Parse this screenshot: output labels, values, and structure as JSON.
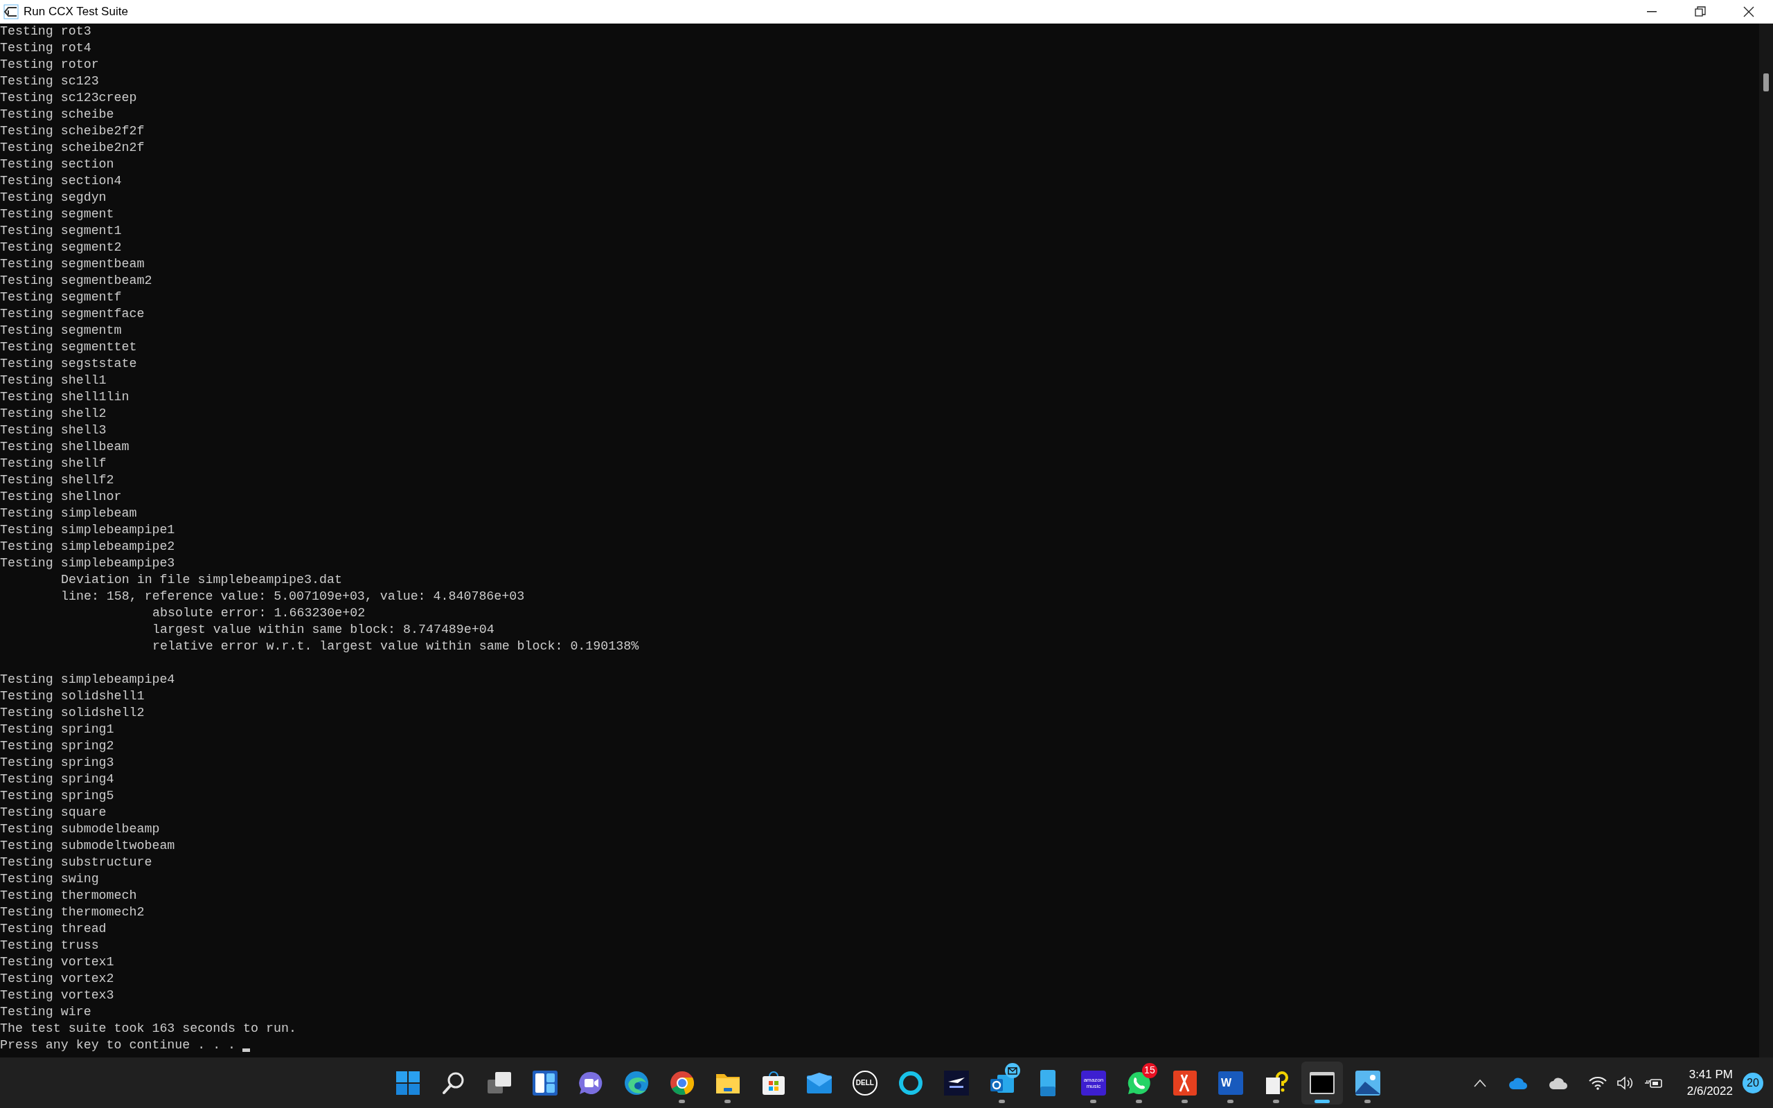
{
  "window": {
    "title": "Run CCX Test Suite"
  },
  "console": {
    "lines": [
      {
        "kind": "output",
        "text": "Testing rot3"
      },
      {
        "kind": "output",
        "text": "Testing rot4"
      },
      {
        "kind": "output",
        "text": "Testing rotor"
      },
      {
        "kind": "output",
        "text": "Testing sc123"
      },
      {
        "kind": "output",
        "text": "Testing sc123creep"
      },
      {
        "kind": "output",
        "text": "Testing scheibe"
      },
      {
        "kind": "output",
        "text": "Testing scheibe2f2f"
      },
      {
        "kind": "output",
        "text": "Testing scheibe2n2f"
      },
      {
        "kind": "output",
        "text": "Testing section"
      },
      {
        "kind": "output",
        "text": "Testing section4"
      },
      {
        "kind": "output",
        "text": "Testing segdyn"
      },
      {
        "kind": "output",
        "text": "Testing segment"
      },
      {
        "kind": "output",
        "text": "Testing segment1"
      },
      {
        "kind": "output",
        "text": "Testing segment2"
      },
      {
        "kind": "output",
        "text": "Testing segmentbeam"
      },
      {
        "kind": "output",
        "text": "Testing segmentbeam2"
      },
      {
        "kind": "output",
        "text": "Testing segmentf"
      },
      {
        "kind": "output",
        "text": "Testing segmentface"
      },
      {
        "kind": "output",
        "text": "Testing segmentm"
      },
      {
        "kind": "output",
        "text": "Testing segmenttet"
      },
      {
        "kind": "output",
        "text": "Testing segststate"
      },
      {
        "kind": "output",
        "text": "Testing shell1"
      },
      {
        "kind": "output",
        "text": "Testing shell1lin"
      },
      {
        "kind": "output",
        "text": "Testing shell2"
      },
      {
        "kind": "output",
        "text": "Testing shell3"
      },
      {
        "kind": "output",
        "text": "Testing shellbeam"
      },
      {
        "kind": "output",
        "text": "Testing shellf"
      },
      {
        "kind": "output",
        "text": "Testing shellf2"
      },
      {
        "kind": "output",
        "text": "Testing shellnor"
      },
      {
        "kind": "output",
        "text": "Testing simplebeam"
      },
      {
        "kind": "output",
        "text": "Testing simplebeampipe1"
      },
      {
        "kind": "output",
        "text": "Testing simplebeampipe2"
      },
      {
        "kind": "output",
        "text": "Testing simplebeampipe3",
        "children": [
          {
            "kind": "output",
            "text": "Deviation in file simplebeampipe3.dat"
          },
          {
            "kind": "output",
            "text": "line: 158, reference value: 5.007109e+03, value: 4.840786e+03",
            "children": [
              {
                "kind": "output",
                "text": "absolute error: 1.663230e+02"
              },
              {
                "kind": "output",
                "text": "largest value within same block: 8.747489e+04"
              },
              {
                "kind": "output",
                "text": "relative error w.r.t. largest value within same block: 0.190138%"
              }
            ]
          }
        ]
      },
      {
        "kind": "blank"
      },
      {
        "kind": "output",
        "text": "Testing simplebeampipe4"
      },
      {
        "kind": "output",
        "text": "Testing solidshell1"
      },
      {
        "kind": "output",
        "text": "Testing solidshell2"
      },
      {
        "kind": "output",
        "text": "Testing spring1"
      },
      {
        "kind": "output",
        "text": "Testing spring2"
      },
      {
        "kind": "output",
        "text": "Testing spring3"
      },
      {
        "kind": "output",
        "text": "Testing spring4"
      },
      {
        "kind": "output",
        "text": "Testing spring5"
      },
      {
        "kind": "output",
        "text": "Testing square"
      },
      {
        "kind": "output",
        "text": "Testing submodelbeamp"
      },
      {
        "kind": "output",
        "text": "Testing submodeltwobeam"
      },
      {
        "kind": "output",
        "text": "Testing substructure"
      },
      {
        "kind": "output",
        "text": "Testing swing"
      },
      {
        "kind": "output",
        "text": "Testing thermomech"
      },
      {
        "kind": "output",
        "text": "Testing thermomech2"
      },
      {
        "kind": "output",
        "text": "Testing thread"
      },
      {
        "kind": "output",
        "text": "Testing truss"
      },
      {
        "kind": "output",
        "text": "Testing vortex1"
      },
      {
        "kind": "output",
        "text": "Testing vortex2"
      },
      {
        "kind": "output",
        "text": "Testing vortex3"
      },
      {
        "kind": "output",
        "text": "Testing wire"
      },
      {
        "kind": "output",
        "text": "The test suite took 163 seconds to run."
      },
      {
        "kind": "prompt",
        "text": "Press any key to continue . . ."
      }
    ]
  },
  "taskbar": {
    "apps": [
      {
        "kind": "start",
        "running": false,
        "selected": false
      },
      {
        "kind": "search",
        "running": false,
        "selected": false
      },
      {
        "kind": "taskview",
        "running": false,
        "selected": false
      },
      {
        "kind": "widgets",
        "running": false,
        "selected": false
      },
      {
        "kind": "chat",
        "running": false,
        "selected": false
      },
      {
        "kind": "edge",
        "running": false,
        "selected": false
      },
      {
        "kind": "chrome",
        "running": true,
        "selected": false
      },
      {
        "kind": "folder",
        "running": true,
        "selected": false
      },
      {
        "kind": "store",
        "running": false,
        "selected": false
      },
      {
        "kind": "mail",
        "running": false,
        "selected": false
      },
      {
        "kind": "dell",
        "label": "DELL",
        "running": false,
        "selected": false
      },
      {
        "kind": "ring",
        "running": false,
        "selected": false
      },
      {
        "kind": "game",
        "running": false,
        "selected": false
      },
      {
        "kind": "outlook",
        "running": true,
        "selected": false,
        "notify": true
      },
      {
        "kind": "phone",
        "running": false,
        "selected": false
      },
      {
        "kind": "music",
        "label": "amazon music",
        "running": true,
        "selected": false
      },
      {
        "kind": "whatsapp",
        "running": true,
        "selected": false,
        "badge": "15"
      },
      {
        "kind": "acrobat",
        "running": true,
        "selected": false
      },
      {
        "kind": "word",
        "label": "W",
        "running": true,
        "selected": false
      },
      {
        "kind": "help",
        "running": true,
        "selected": false
      },
      {
        "kind": "terminal",
        "running": true,
        "selected": true
      },
      {
        "kind": "photos",
        "running": true,
        "selected": false
      }
    ],
    "tray": {
      "time": "3:41 PM",
      "date": "2/6/2022",
      "notifications": "20"
    }
  }
}
